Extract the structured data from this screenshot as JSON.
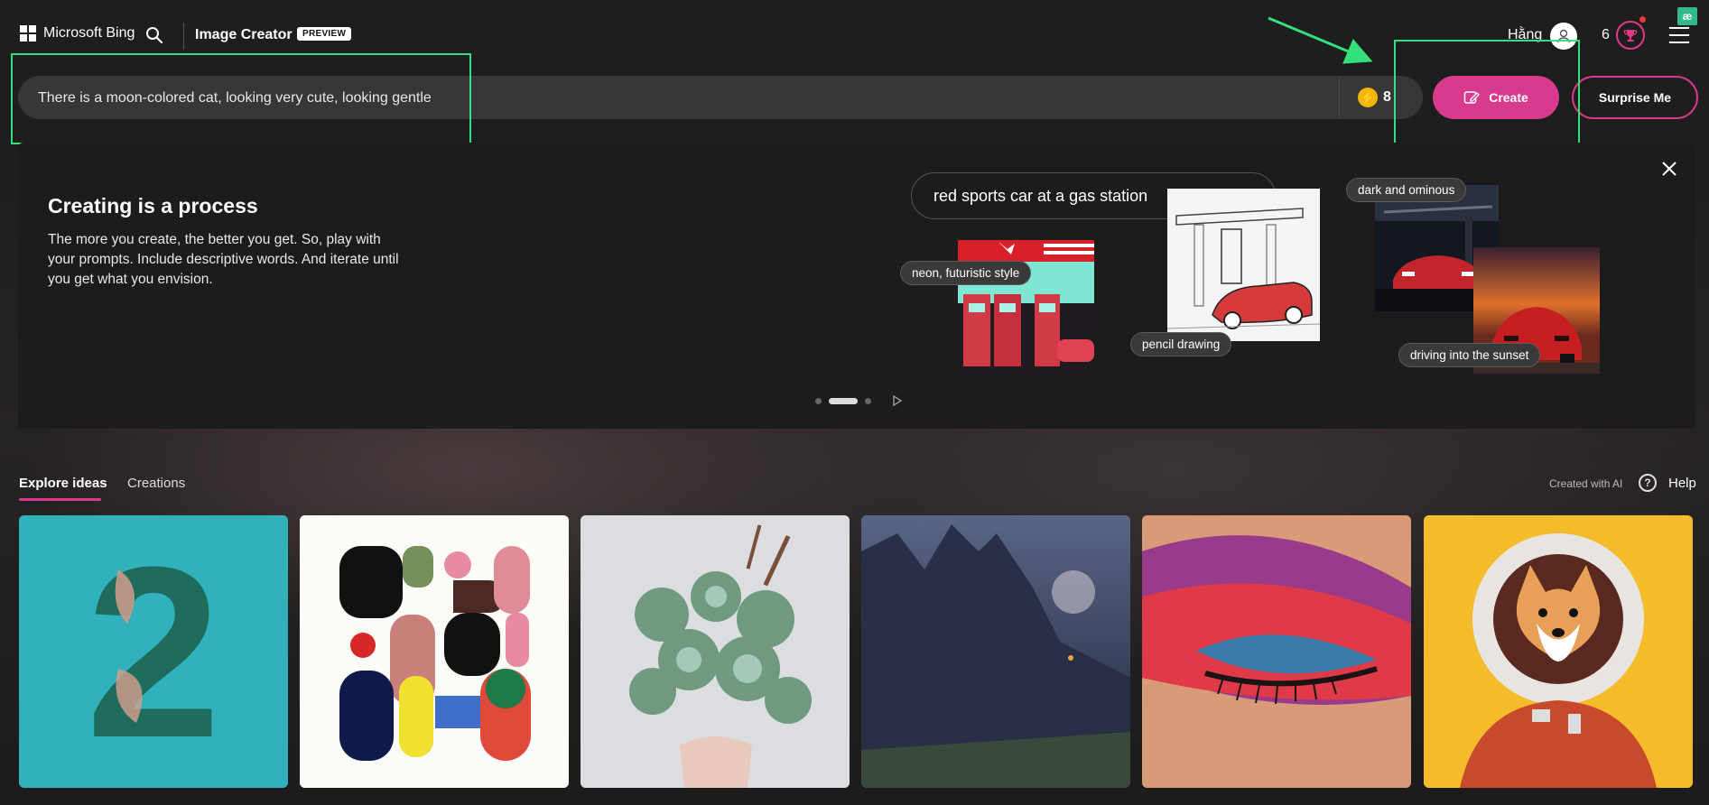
{
  "header": {
    "brand": "Microsoft Bing",
    "app_title": "Image Creator",
    "badge": "PREVIEW",
    "user_name": "Hằng",
    "reward_count": "6",
    "extension_label": "æ"
  },
  "prompt": {
    "value": "There is a moon-colored cat, looking very cute, looking gentle",
    "boosts": "8",
    "create_label": "Create",
    "surprise_label": "Surprise Me"
  },
  "info_card": {
    "title": "Creating is a process",
    "description": "The more you create, the better you get. So, play with your prompts. Include descriptive words. And iterate until you get what you envision.",
    "example_prompt": "red sports car at a gas station",
    "tags": [
      "neon, futuristic style",
      "pencil drawing",
      "dark and ominous",
      "driving into the sunset"
    ]
  },
  "tabs": {
    "explore": "Explore ideas",
    "creations": "Creations",
    "created_with_ai": "Created with AI",
    "help": "Help"
  },
  "gallery": {
    "number_tile": "2"
  },
  "colors": {
    "accent": "#d83a8d",
    "highlight": "#33e07a",
    "boost": "#f2b705"
  }
}
